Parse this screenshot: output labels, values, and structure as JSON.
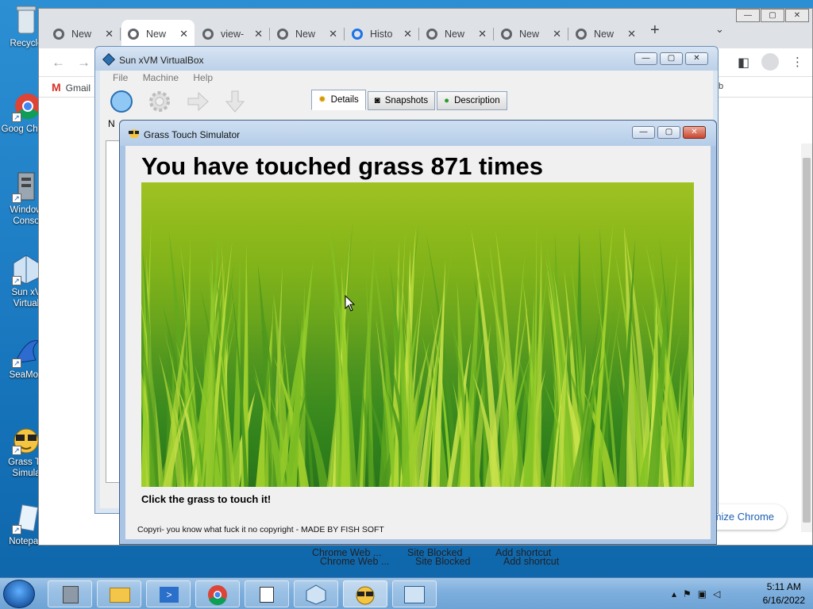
{
  "desktop": {
    "icons": [
      {
        "label": "Recycle",
        "name": "recycle-bin-icon"
      },
      {
        "label": "Goog Chron",
        "name": "google-chrome-icon"
      },
      {
        "label": "Window Conso",
        "name": "windows-console-icon"
      },
      {
        "label": "Sun xV Virtual",
        "name": "sun-xvm-virtualbox-icon"
      },
      {
        "label": "SeaMon",
        "name": "seamonkey-icon"
      },
      {
        "label": "Grass To Simula",
        "name": "grass-touch-simulator-icon"
      },
      {
        "label": "Notepad",
        "name": "notepad-icon"
      }
    ]
  },
  "chrome": {
    "tabs": [
      {
        "label": "New",
        "icon": "chrome-icon"
      },
      {
        "label": "New",
        "icon": "chrome-icon"
      },
      {
        "label": "view-",
        "icon": "chrome-icon"
      },
      {
        "label": "New",
        "icon": "chrome-icon"
      },
      {
        "label": "Histo",
        "icon": "history-icon"
      },
      {
        "label": "New",
        "icon": "chrome-icon"
      },
      {
        "label": "New",
        "icon": "chrome-icon"
      },
      {
        "label": "New",
        "icon": "chrome-icon"
      }
    ],
    "bookmark_gmail": "Gmail",
    "customize_label": "mize Chrome",
    "bottom_items": [
      "Chrome Web ...",
      "Site Blocked",
      "Add shortcut"
    ]
  },
  "virtualbox": {
    "title": "Sun xVM VirtualBox",
    "menu": [
      "File",
      "Machine",
      "Help"
    ],
    "tabs": [
      "Details",
      "Snapshots",
      "Description"
    ],
    "toolbar_label": "N"
  },
  "grass_app": {
    "title": "Grass Touch Simulator",
    "touch_prefix": "You have touched grass ",
    "touch_count": "871",
    "touch_suffix": " times",
    "hint": "Click the grass to touch it!",
    "copyright": "Copyri- you know what fuck it no copyright - MADE BY FISH SOFT"
  },
  "taskbar": {
    "time": "5:11 AM",
    "date": "6/16/2022"
  }
}
